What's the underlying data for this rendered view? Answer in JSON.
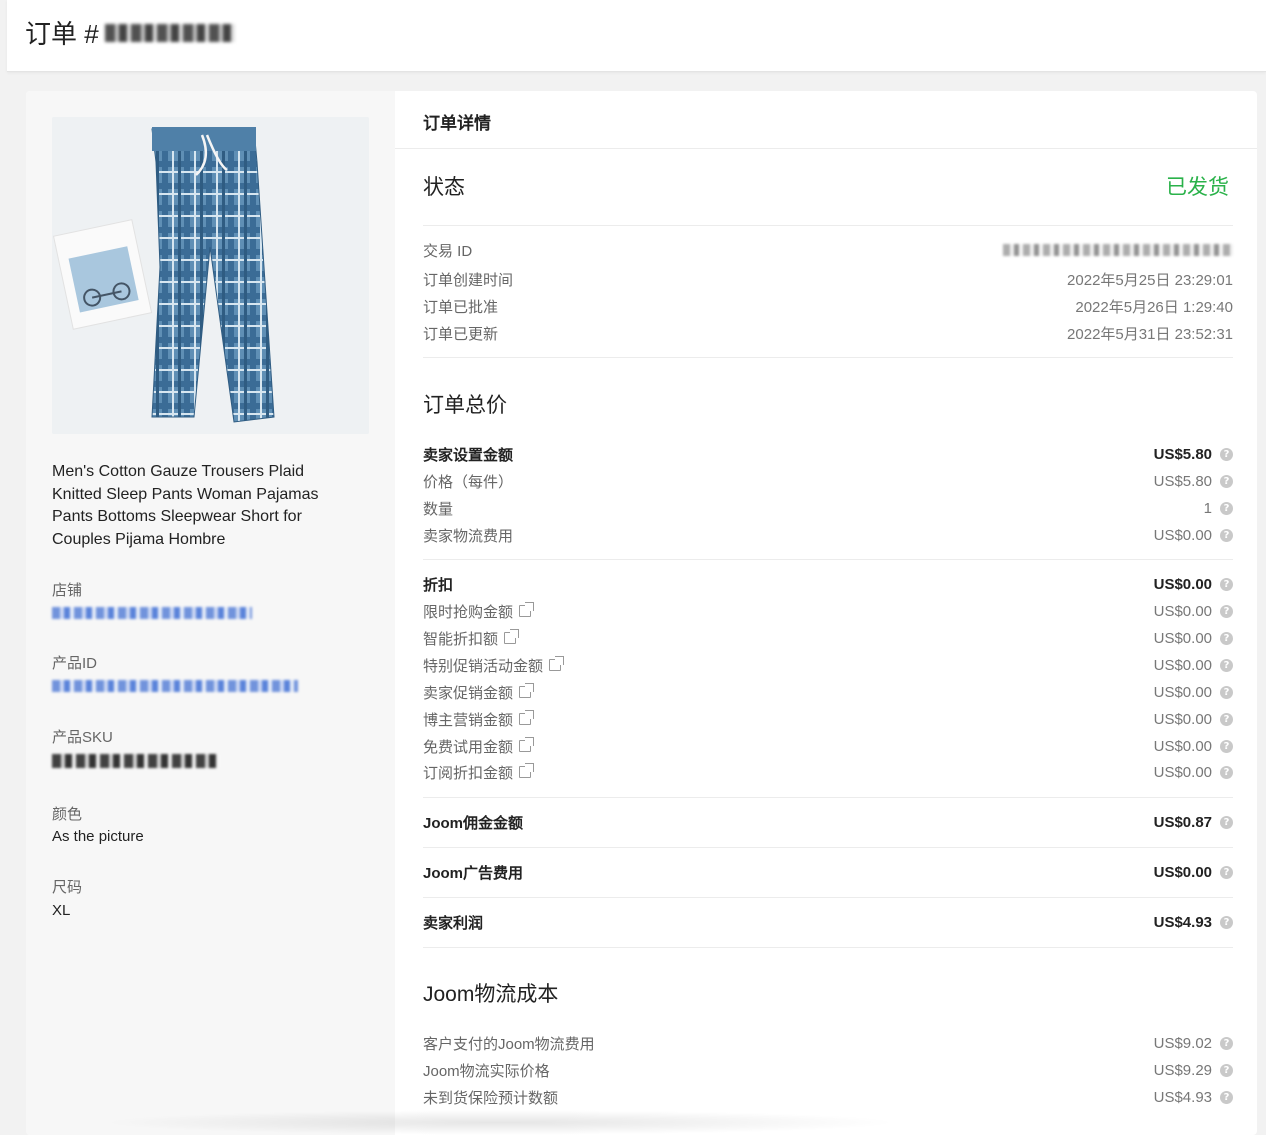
{
  "header": {
    "title": "订单 #"
  },
  "product": {
    "image_icon": "plaid-pants-image",
    "title": "Men's Cotton Gauze Trousers Plaid Knitted Sleep Pants Woman Pajamas Pants Bottoms Sleepwear Short for Couples Pijama Hombre",
    "store_label": "店铺",
    "product_id_label": "产品ID",
    "sku_label": "产品SKU",
    "color_label": "颜色",
    "color_value": "As the picture",
    "size_label": "尺码",
    "size_value": "XL"
  },
  "details": {
    "heading": "订单详情",
    "status": {
      "title": "状态",
      "value": "已发货",
      "value_color": "#2ab24a",
      "rows": [
        {
          "label": "交易 ID",
          "value": ""
        },
        {
          "label": "订单创建时间",
          "value": "2022年5月25日 23:29:01"
        },
        {
          "label": "订单已批准",
          "value": "2022年5月26日 1:29:40"
        },
        {
          "label": "订单已更新",
          "value": "2022年5月31日 23:52:31"
        }
      ]
    },
    "total": {
      "title": "订单总价",
      "seller_amount": {
        "label": "卖家设置金额",
        "value": "US$5.80"
      },
      "rows": [
        {
          "label": "价格（每件）",
          "value": "US$5.80"
        },
        {
          "label": "数量",
          "value": "1"
        },
        {
          "label": "卖家物流费用",
          "value": "US$0.00"
        }
      ],
      "discount": {
        "label": "折扣",
        "value": "US$0.00"
      },
      "discount_rows": [
        {
          "label": "限时抢购金额",
          "value": "US$0.00"
        },
        {
          "label": "智能折扣额",
          "value": "US$0.00"
        },
        {
          "label": "特别促销活动金额",
          "value": "US$0.00"
        },
        {
          "label": "卖家促销金额",
          "value": "US$0.00"
        },
        {
          "label": "博主营销金额",
          "value": "US$0.00"
        },
        {
          "label": "免费试用金额",
          "value": "US$0.00"
        },
        {
          "label": "订阅折扣金额",
          "value": "US$0.00"
        }
      ],
      "commission": {
        "label": "Joom佣金金额",
        "value": "US$0.87"
      },
      "ad_fee": {
        "label": "Joom广告费用",
        "value": "US$0.00"
      },
      "profit": {
        "label": "卖家利润",
        "value": "US$4.93"
      }
    },
    "logistics": {
      "title": "Joom物流成本",
      "rows": [
        {
          "label": "客户支付的Joom物流费用",
          "value": "US$9.02"
        },
        {
          "label": "Joom物流实际价格",
          "value": "US$9.29"
        },
        {
          "label": "未到货保险预计数额",
          "value": "US$4.93"
        }
      ]
    }
  },
  "icons": {
    "help": "?",
    "external": "external-link-icon"
  }
}
